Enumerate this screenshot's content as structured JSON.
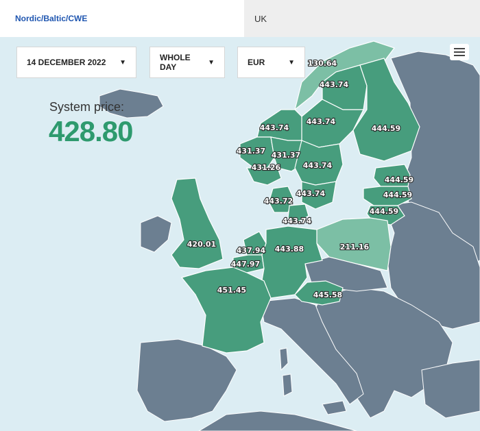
{
  "tabs": {
    "nordic": "Nordic/Baltic/CWE",
    "uk": "UK"
  },
  "controls": {
    "date": "14 DECEMBER 2022",
    "period": "WHOLE DAY",
    "currency": "EUR",
    "menu_icon": "hamburger-menu-icon",
    "caret_icon": "caret-down-icon"
  },
  "system_price": {
    "label": "System price:",
    "value": "428.80"
  },
  "colors": {
    "sea": "#dcedf3",
    "land": "#6c7f91",
    "zone_high": "#479d7d",
    "zone_light": "#7cbfa5",
    "system_price": "#2e9a6e"
  },
  "areas": {
    "no4": "130.64",
    "se1": "443.74",
    "se2": "443.74",
    "fi": "444.59",
    "no3": "443.74",
    "no5": "431.37",
    "no1": "431.37",
    "no2": "431.26",
    "se3": "443.74",
    "ee": "444.59",
    "lv": "444.59",
    "lt": "444.59",
    "dk1": "443.72",
    "se4": "443.74",
    "dk2": "443.74",
    "pl": "211.16",
    "gb": "420.01",
    "nl": "437.94",
    "be": "447.97",
    "de": "443.88",
    "fr": "451.45",
    "at": "445.58"
  }
}
